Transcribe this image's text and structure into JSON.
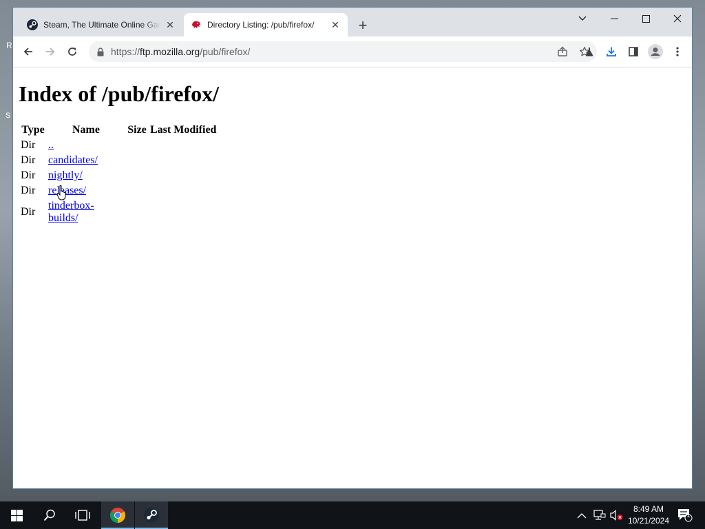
{
  "desktop": {
    "edge_letters": [
      "R",
      "S"
    ]
  },
  "browser": {
    "tabs": [
      {
        "title": "Steam, The Ultimate Online Game Platform",
        "favicon": "steam-icon",
        "active": false
      },
      {
        "title": "Directory Listing: /pub/firefox/",
        "favicon": "mozilla-dino-icon",
        "active": true
      }
    ],
    "address": {
      "scheme": "https://",
      "host": "ftp.mozilla.org",
      "path": "/pub/firefox/"
    },
    "toolbar_icons": [
      "back-icon",
      "forward-icon",
      "reload-icon",
      "share-icon",
      "star-icon",
      "labs-icon",
      "download-icon",
      "side-panel-icon",
      "profile-icon",
      "menu-icon"
    ]
  },
  "page": {
    "heading": "Index of /pub/firefox/",
    "columns": {
      "type": "Type",
      "name": "Name",
      "size": "Size",
      "modified": "Last Modified"
    },
    "rows": [
      {
        "type": "Dir",
        "name": "..",
        "size": "",
        "modified": ""
      },
      {
        "type": "Dir",
        "name": "candidates/",
        "size": "",
        "modified": ""
      },
      {
        "type": "Dir",
        "name": "nightly/",
        "size": "",
        "modified": ""
      },
      {
        "type": "Dir",
        "name": "releases/",
        "size": "",
        "modified": ""
      },
      {
        "type": "Dir",
        "name": "tinderbox-builds/",
        "size": "",
        "modified": ""
      }
    ]
  },
  "taskbar": {
    "clock_time": "8:49 AM",
    "clock_date": "10/21/2024",
    "notification_count": "1",
    "accent": "#76b9ed"
  }
}
